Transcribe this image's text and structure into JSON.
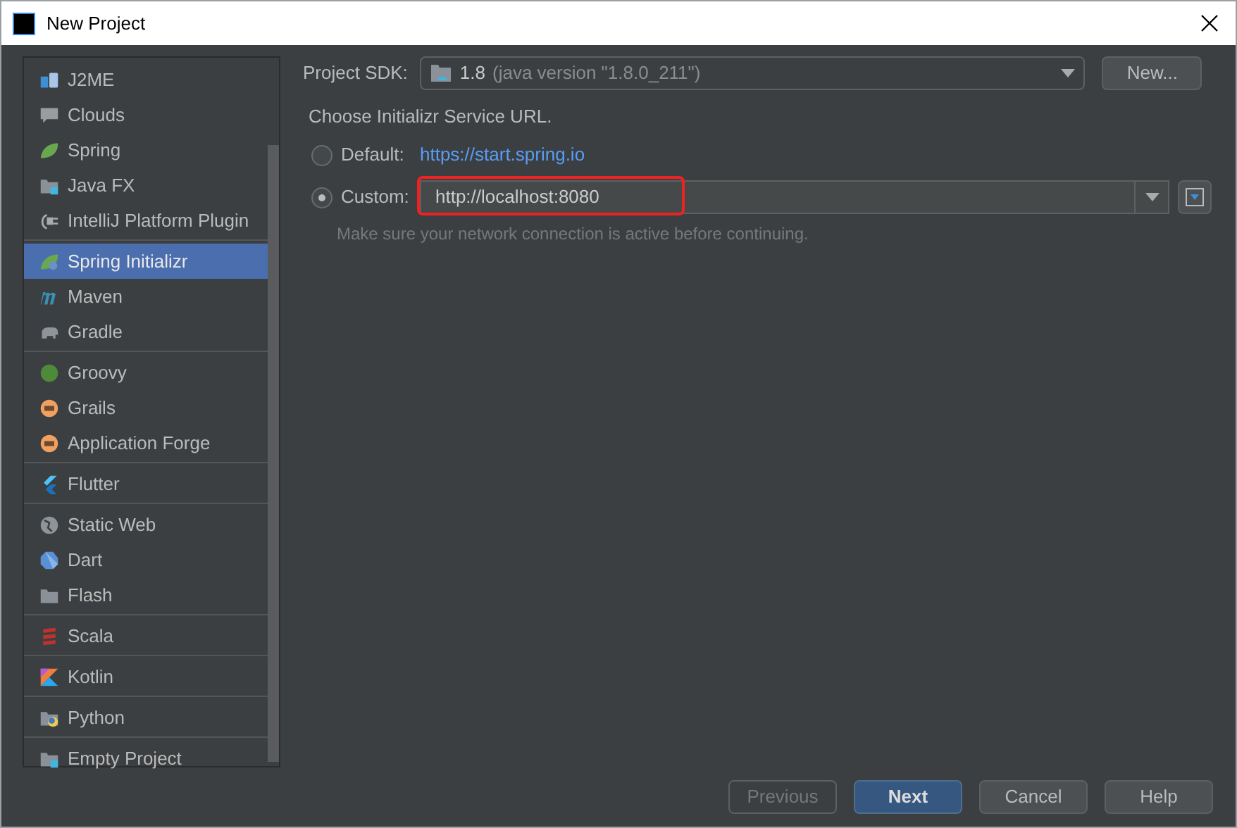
{
  "window": {
    "title": "New Project"
  },
  "sidebar": {
    "groups": [
      [
        {
          "label": "J2ME",
          "selected": false
        },
        {
          "label": "Clouds",
          "selected": false
        },
        {
          "label": "Spring",
          "selected": false
        },
        {
          "label": "Java FX",
          "selected": false
        },
        {
          "label": "IntelliJ Platform Plugin",
          "selected": false
        }
      ],
      [
        {
          "label": "Spring Initializr",
          "selected": true
        },
        {
          "label": "Maven",
          "selected": false
        },
        {
          "label": "Gradle",
          "selected": false
        }
      ],
      [
        {
          "label": "Groovy",
          "selected": false
        },
        {
          "label": "Grails",
          "selected": false
        },
        {
          "label": "Application Forge",
          "selected": false
        }
      ],
      [
        {
          "label": "Flutter",
          "selected": false
        }
      ],
      [
        {
          "label": "Static Web",
          "selected": false
        },
        {
          "label": "Dart",
          "selected": false
        },
        {
          "label": "Flash",
          "selected": false
        }
      ],
      [
        {
          "label": "Scala",
          "selected": false
        }
      ],
      [
        {
          "label": "Kotlin",
          "selected": false
        }
      ],
      [
        {
          "label": "Python",
          "selected": false
        }
      ],
      [
        {
          "label": "Empty Project",
          "selected": false
        }
      ]
    ]
  },
  "sdk": {
    "label": "Project SDK:",
    "version": "1.8",
    "detail": "(java version \"1.8.0_211\")",
    "new_button": "New..."
  },
  "service": {
    "heading": "Choose Initializr Service URL.",
    "options": [
      {
        "label": "Default:",
        "selected": false,
        "kind": "link",
        "value": "https://start.spring.io"
      },
      {
        "label": "Custom:",
        "selected": true,
        "kind": "field",
        "value": "http://localhost:8080",
        "highlighted": true
      }
    ],
    "hint": "Make sure your network connection is active before continuing."
  },
  "buttons": [
    {
      "label": "Previous",
      "disabled": true,
      "primary": false
    },
    {
      "label": "Next",
      "disabled": false,
      "primary": true
    },
    {
      "label": "Cancel",
      "disabled": false,
      "primary": false
    },
    {
      "label": "Help",
      "disabled": false,
      "primary": false
    }
  ]
}
